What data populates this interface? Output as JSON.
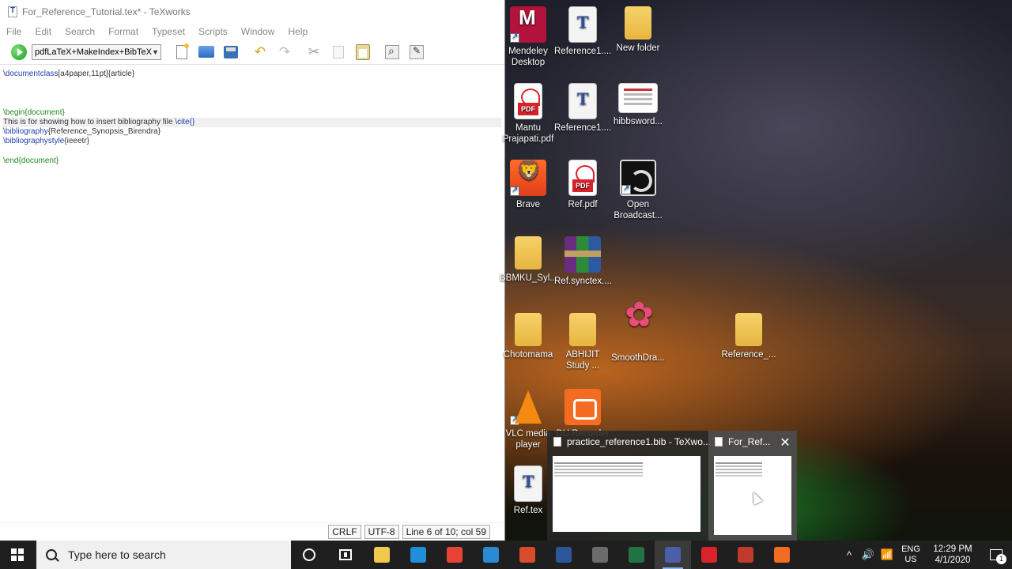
{
  "app": {
    "title": "For_Reference_Tutorial.tex* - TeXworks",
    "menu": [
      "File",
      "Edit",
      "Search",
      "Format",
      "Typeset",
      "Scripts",
      "Window",
      "Help"
    ],
    "typeset_engine": "pdfLaTeX+MakeIndex+BibTeX"
  },
  "editor": {
    "lines": [
      [
        {
          "t": "\\documentclass",
          "c": "cmd"
        },
        {
          "t": "[a4paper,11pt]{article}",
          "c": "arg"
        }
      ],
      [],
      [],
      [],
      [
        {
          "t": "\\begin{document}",
          "c": "env"
        }
      ],
      [
        {
          "t": "This is for showing how to insert bibliography file ",
          "c": "arg"
        },
        {
          "t": "\\cite{}",
          "c": "cmd"
        }
      ],
      [
        {
          "t": "\\bibliography",
          "c": "cmd"
        },
        {
          "t": "{Reference_Synopsis_Birendra}",
          "c": "arg"
        }
      ],
      [
        {
          "t": "\\bibliographystyle",
          "c": "cmd"
        },
        {
          "t": "{ieeetr}",
          "c": "arg"
        }
      ],
      [],
      [
        {
          "t": "\\end{document}",
          "c": "env"
        }
      ]
    ],
    "current_line": 6
  },
  "status": {
    "line_ending": "CRLF",
    "encoding": "UTF-8",
    "position": "Line 6 of 10; col 59"
  },
  "desktop_icons": [
    {
      "label": "Mendeley\nDesktop",
      "icon": "mendeley-icon",
      "style": "g-mendeley",
      "shortcut": true
    },
    {
      "label": "Reference1....",
      "icon": "texworks-file-icon",
      "style": "g-tex",
      "shortcut": false
    },
    {
      "label": "New folder",
      "icon": "folder-icon",
      "style": "g-folder",
      "shortcut": false
    },
    {
      "label": "Mantu\nPrajapati.pdf",
      "icon": "pdf-icon",
      "style": "g-pdf",
      "shortcut": false
    },
    {
      "label": "Reference1....",
      "icon": "texworks-file-icon",
      "style": "g-tex",
      "shortcut": false
    },
    {
      "label": "hibbsword...",
      "icon": "document-icon",
      "style": "g-doc",
      "shortcut": false
    },
    {
      "label": "Brave",
      "icon": "brave-icon",
      "style": "g-brave",
      "shortcut": true
    },
    {
      "label": "Ref.pdf",
      "icon": "pdf-icon",
      "style": "g-pdf",
      "shortcut": false
    },
    {
      "label": "Open\nBroadcast...",
      "icon": "obs-icon",
      "style": "g-obs",
      "shortcut": true
    },
    {
      "label": "BBMKU_Syl...",
      "icon": "zip-folder-icon",
      "style": "g-folder",
      "shortcut": false
    },
    {
      "label": "Ref.synctex....",
      "icon": "winrar-icon",
      "style": "g-rar",
      "shortcut": false
    },
    {
      "label": "Chotomama",
      "icon": "folder-icon",
      "style": "g-folder",
      "shortcut": false
    },
    {
      "label": "ABHIJIT\nStudy ...",
      "icon": "zip-folder-icon",
      "style": "g-folder",
      "shortcut": false
    },
    {
      "label": "SmoothDra...",
      "icon": "smoothdraw-icon",
      "style": "g-smooth",
      "shortcut": false
    },
    {
      "label": "Reference_...",
      "icon": "folder-icon",
      "style": "g-folder",
      "shortcut": false
    },
    {
      "label": "VLC media\nplayer",
      "icon": "vlc-icon",
      "style": "g-vlc",
      "shortcut": true
    },
    {
      "label": "DU Recorder",
      "icon": "du-recorder-icon",
      "style": "g-du",
      "shortcut": false
    },
    {
      "label": "Ref.tex",
      "icon": "texworks-file-icon",
      "style": "g-tex",
      "shortcut": false
    }
  ],
  "preview": {
    "items": [
      {
        "title": "practice_reference1.bib - TeXwo...",
        "active": false
      },
      {
        "title": "For_Ref...",
        "active": true
      }
    ]
  },
  "taskbar": {
    "search_placeholder": "Type here to search",
    "pinned": [
      {
        "name": "file-explorer",
        "color": "#f2c94c"
      },
      {
        "name": "edge",
        "color": "#1f8fd8"
      },
      {
        "name": "chrome",
        "color": "#e94235"
      },
      {
        "name": "visual-studio",
        "color": "#2a8ad4"
      },
      {
        "name": "app-red",
        "color": "#d94b2b"
      },
      {
        "name": "word",
        "color": "#2b579a"
      },
      {
        "name": "video-editor",
        "color": "#6b6b6b"
      },
      {
        "name": "excel",
        "color": "#217346"
      },
      {
        "name": "texworks",
        "color": "#4a5fa8"
      },
      {
        "name": "acrobat",
        "color": "#d8232a"
      },
      {
        "name": "app-checkered",
        "color": "#c0392b"
      },
      {
        "name": "du-recorder",
        "color": "#f36c22"
      }
    ],
    "active_app": "texworks",
    "tray": {
      "lang_top": "ENG",
      "lang_bottom": "US",
      "time": "12:29 PM",
      "date": "4/1/2020",
      "notification_count": "1"
    }
  }
}
